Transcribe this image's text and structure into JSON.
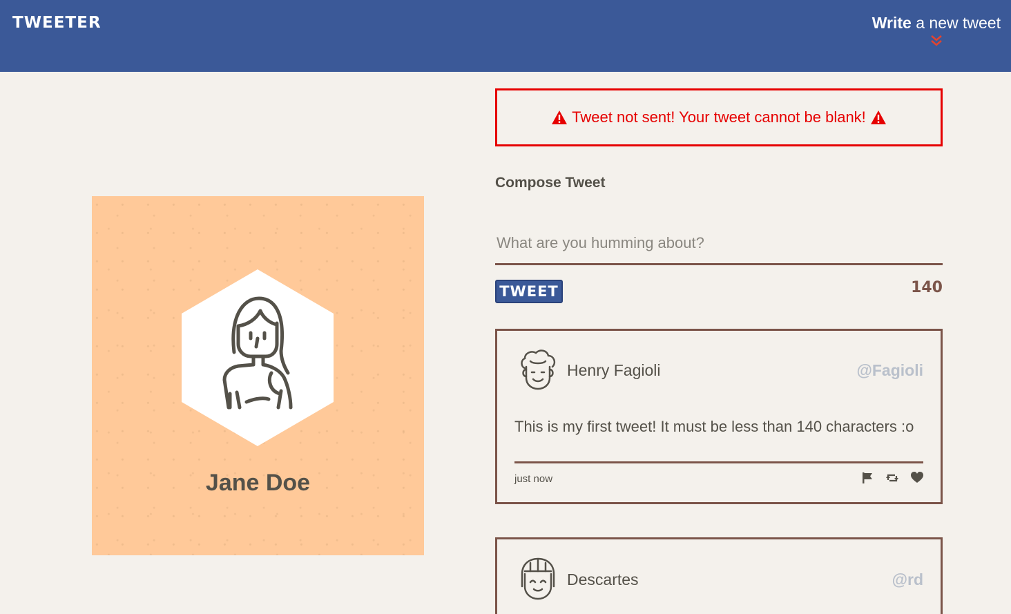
{
  "nav": {
    "brand": "TWEETER",
    "compose_bold": "Write",
    "compose_rest": " a new tweet",
    "chevron_icon": "double-chevron-down-icon"
  },
  "profile": {
    "name": "Jane Doe",
    "background_color": "#ffc999"
  },
  "error": {
    "message": "Tweet not sent! Your tweet cannot be blank!",
    "color": "#e60000"
  },
  "compose": {
    "title": "Compose Tweet",
    "placeholder": "What are you humming about?",
    "value": "",
    "button_label": "TWEET",
    "char_count": "140"
  },
  "tweets": [
    {
      "name": "Henry Fagioli",
      "handle": "@Fagioli",
      "text": "This is my first tweet! It must be less than 140 characters :o",
      "time": "just now",
      "actions": [
        "flag-icon",
        "retweet-icon",
        "heart-icon"
      ]
    },
    {
      "name": "Descartes",
      "handle": "@rd"
    }
  ],
  "colors": {
    "nav": "#3b5998",
    "background": "#f4f1ec",
    "accent_brown": "#7b5449",
    "handle_gray": "#b9c0cb"
  }
}
